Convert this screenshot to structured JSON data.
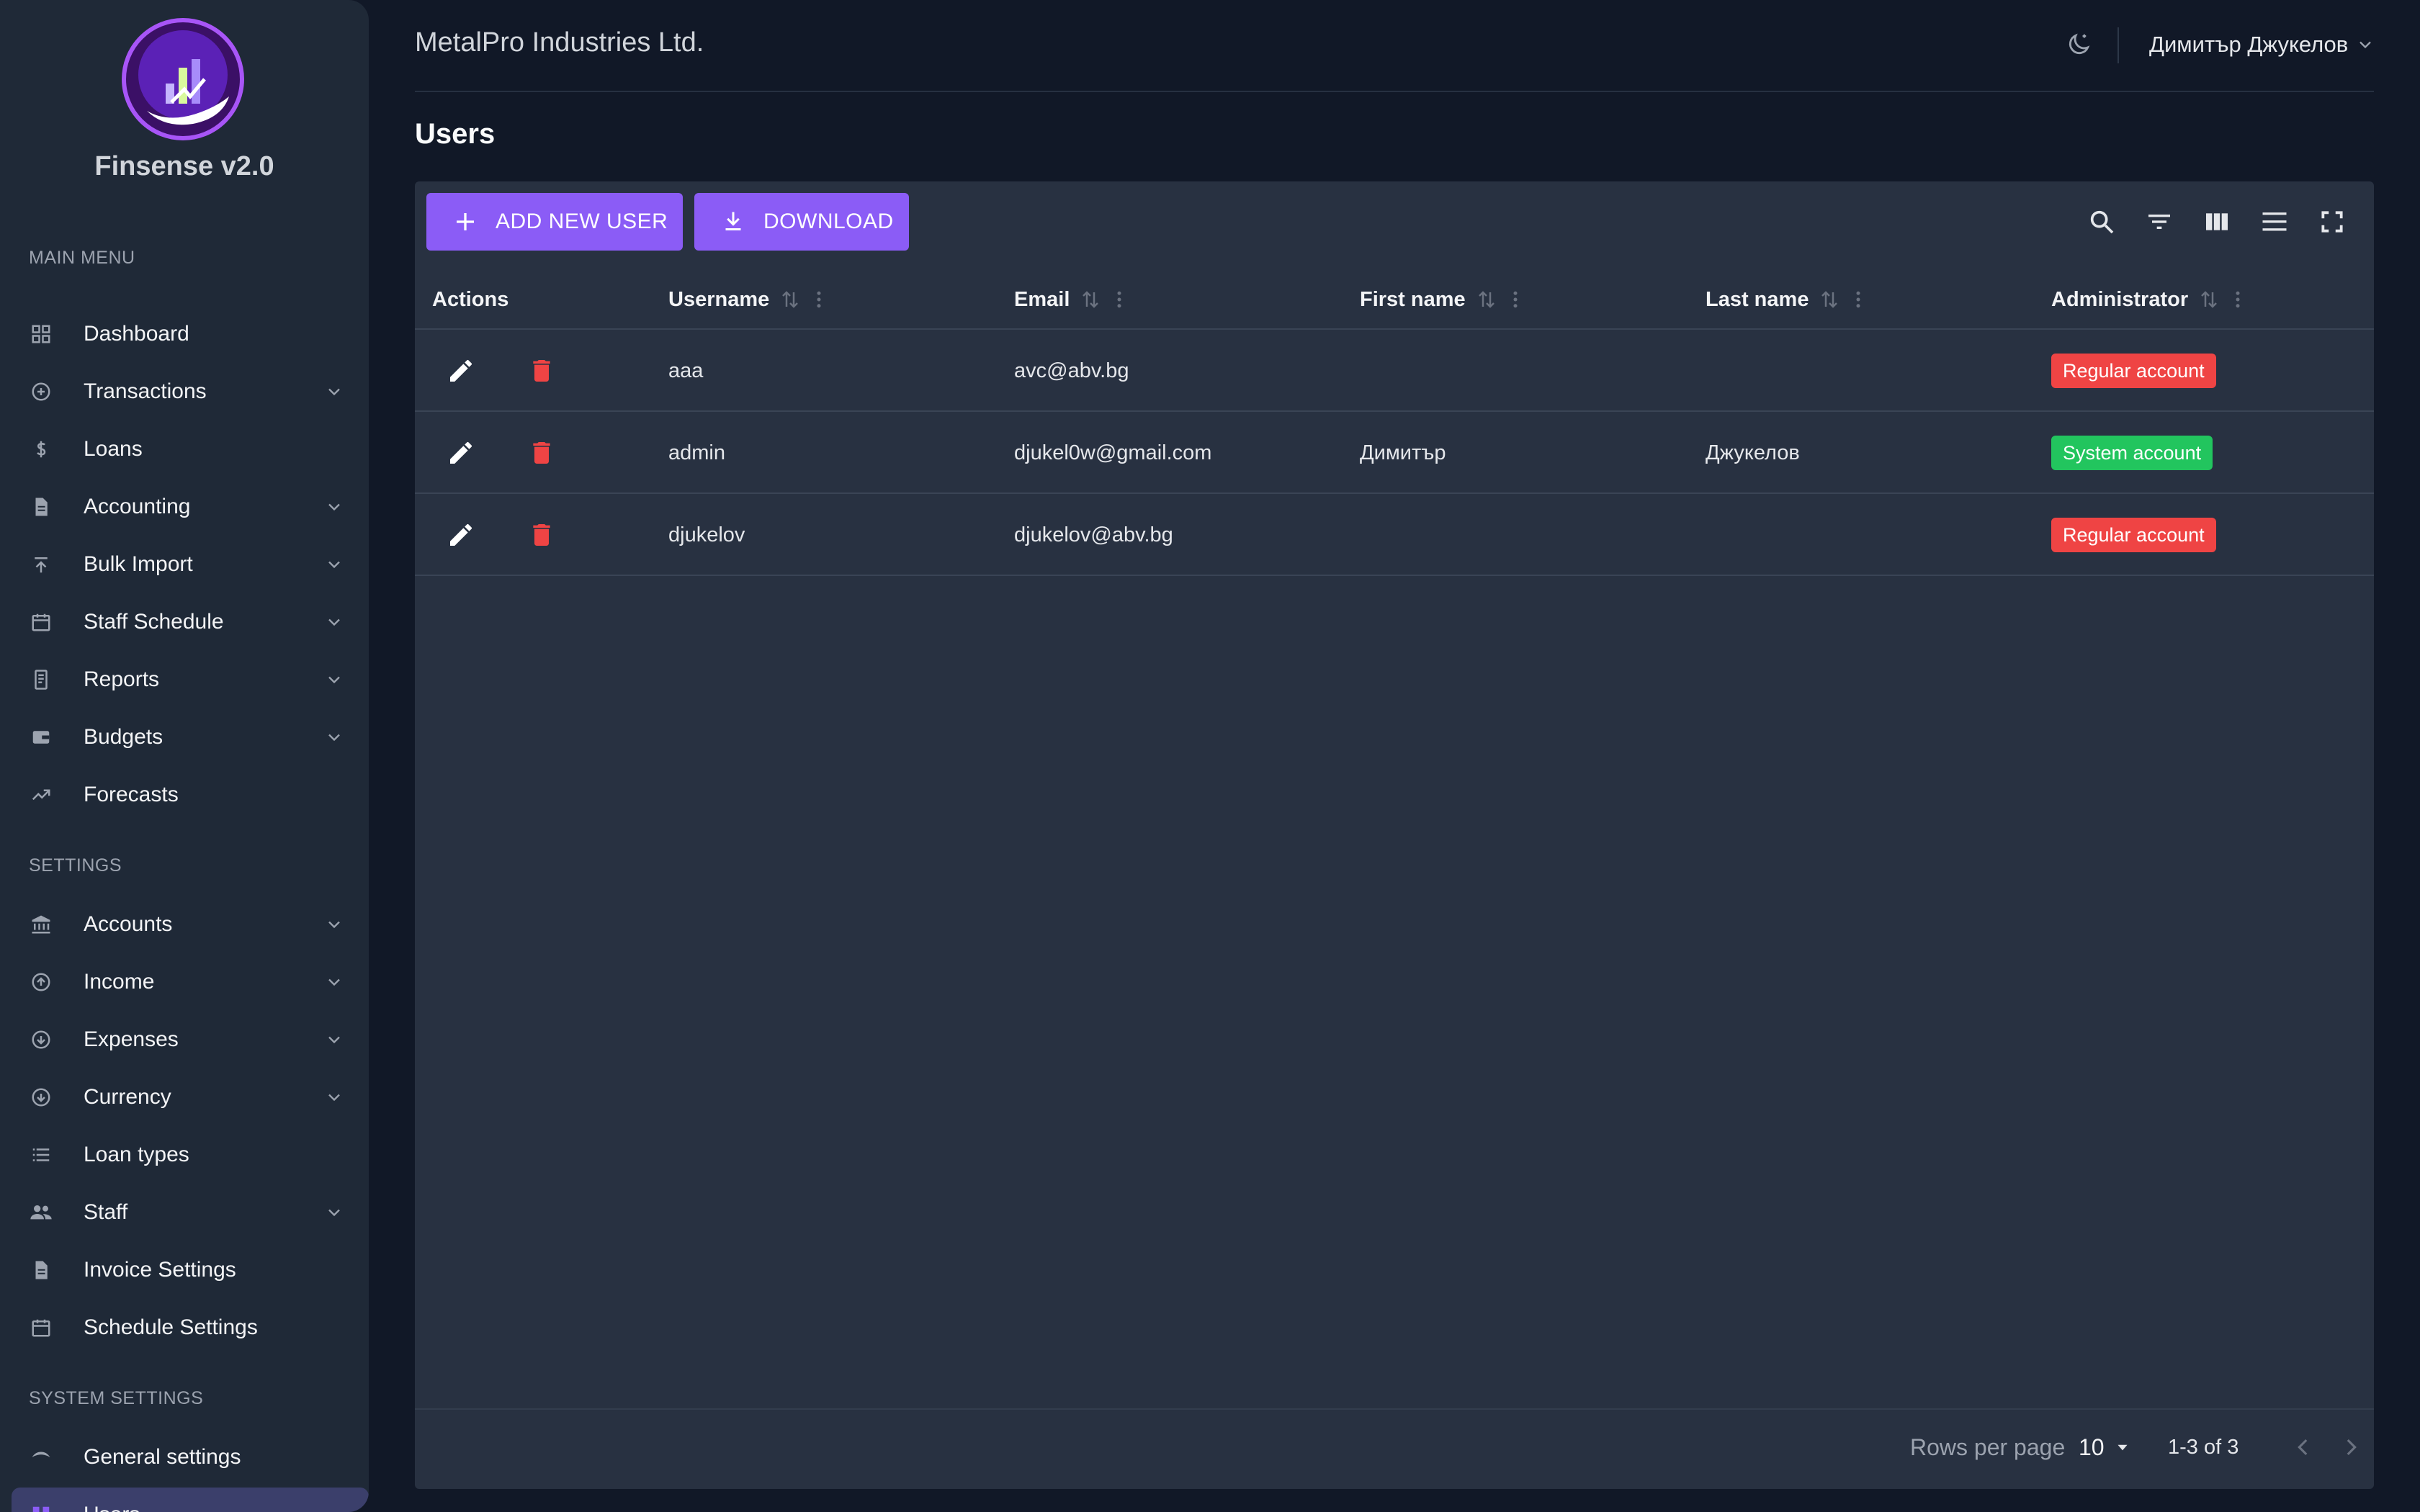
{
  "brand": {
    "name": "Finsense v2.0"
  },
  "sidebar": {
    "main_menu_title": "MAIN MENU",
    "settings_title": "SETTINGS",
    "system_settings_title": "SYSTEM SETTINGS",
    "main_items": [
      {
        "label": "Dashboard",
        "icon": "dashboard-icon",
        "expandable": false
      },
      {
        "label": "Transactions",
        "icon": "transactions-icon",
        "expandable": true
      },
      {
        "label": "Loans",
        "icon": "dollar-icon",
        "expandable": false
      },
      {
        "label": "Accounting",
        "icon": "document-icon",
        "expandable": true
      },
      {
        "label": "Bulk Import",
        "icon": "upload-icon",
        "expandable": true
      },
      {
        "label": "Staff Schedule",
        "icon": "calendar-icon",
        "expandable": true
      },
      {
        "label": "Reports",
        "icon": "reports-icon",
        "expandable": true
      },
      {
        "label": "Budgets",
        "icon": "wallet-icon",
        "expandable": true
      },
      {
        "label": "Forecasts",
        "icon": "trend-icon",
        "expandable": false
      }
    ],
    "settings_items": [
      {
        "label": "Accounts",
        "icon": "bank-icon",
        "expandable": true
      },
      {
        "label": "Income",
        "icon": "arrow-up-circle-icon",
        "expandable": true
      },
      {
        "label": "Expenses",
        "icon": "arrow-down-circle-icon",
        "expandable": true
      },
      {
        "label": "Currency",
        "icon": "currency-icon",
        "expandable": true
      },
      {
        "label": "Loan types",
        "icon": "list-icon",
        "expandable": false
      },
      {
        "label": "Staff",
        "icon": "people-icon",
        "expandable": true
      },
      {
        "label": "Invoice Settings",
        "icon": "invoice-icon",
        "expandable": false
      },
      {
        "label": "Schedule Settings",
        "icon": "calendar-icon",
        "expandable": false
      }
    ],
    "system_items": [
      {
        "label": "General settings",
        "icon": "general-icon",
        "expandable": false
      },
      {
        "label": "Users",
        "icon": "users-icon",
        "expandable": false,
        "active": true
      }
    ]
  },
  "header": {
    "company": "MetalPro Industries Ltd.",
    "user_name": "Димитър Джукелов",
    "theme_icon": "moon-icon"
  },
  "page": {
    "title": "Users"
  },
  "toolbar": {
    "add_label": "ADD NEW USER",
    "download_label": "DOWNLOAD",
    "icons": [
      "search-icon",
      "filter-icon",
      "columns-icon",
      "density-icon",
      "fullscreen-icon"
    ]
  },
  "table": {
    "columns": [
      "Actions",
      "Username",
      "Email",
      "First name",
      "Last name",
      "Administrator"
    ],
    "rows": [
      {
        "username": "aaa",
        "email": "avc@abv.bg",
        "first_name": "",
        "last_name": "",
        "admin": "Regular account",
        "admin_type": "regular"
      },
      {
        "username": "admin",
        "email": "djukel0w@gmail.com",
        "first_name": "Димитър",
        "last_name": "Джукелов",
        "admin": "System account",
        "admin_type": "system"
      },
      {
        "username": "djukelov",
        "email": "djukelov@abv.bg",
        "first_name": "",
        "last_name": "",
        "admin": "Regular account",
        "admin_type": "regular"
      }
    ]
  },
  "pagination": {
    "rows_per_page_label": "Rows per page",
    "rows_per_page_value": "10",
    "range": "1-3 of 3"
  },
  "colors": {
    "accent": "#8b5cf6",
    "regular_badge": "#ef4444",
    "system_badge": "#22c55e",
    "delete_icon": "#ef4444"
  }
}
